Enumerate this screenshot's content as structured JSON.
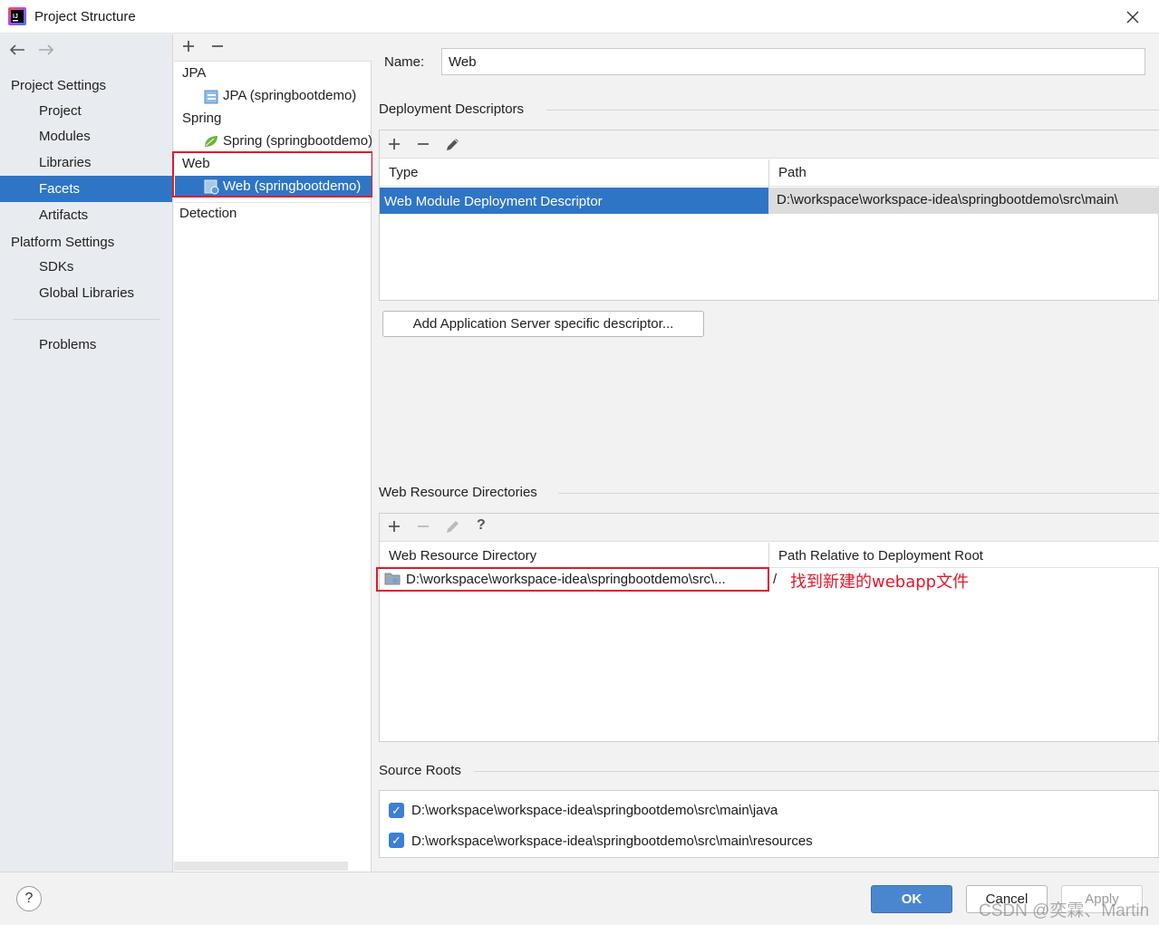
{
  "window": {
    "title": "Project Structure"
  },
  "nav": {
    "project_settings": "Project Settings",
    "items_project": [
      "Project",
      "Modules",
      "Libraries",
      "Facets",
      "Artifacts"
    ],
    "platform_settings": "Platform Settings",
    "items_platform": [
      "SDKs",
      "Global Libraries"
    ],
    "problems": "Problems",
    "selected": "Facets"
  },
  "tree": {
    "groups": [
      {
        "label": "JPA",
        "child": "JPA (springbootdemo)"
      },
      {
        "label": "Spring",
        "child": "Spring (springbootdemo)"
      },
      {
        "label": "Web",
        "child": "Web (springbootdemo)"
      }
    ],
    "detection": "Detection"
  },
  "name_field": {
    "label": "Name:",
    "value": "Web"
  },
  "deployment": {
    "title": "Deployment Descriptors",
    "columns": [
      "Type",
      "Path"
    ],
    "rows": [
      {
        "type": "Web Module Deployment Descriptor",
        "path": "D:\\workspace\\workspace-idea\\springbootdemo\\src\\main\\"
      }
    ],
    "add_button": "Add Application Server specific descriptor..."
  },
  "web_resources": {
    "title": "Web Resource Directories",
    "columns": [
      "Web Resource Directory",
      "Path Relative to Deployment Root"
    ],
    "rows": [
      {
        "directory": "D:\\workspace\\workspace-idea\\springbootdemo\\src\\...",
        "relative": "/"
      }
    ],
    "annotation": "找到新建的webapp文件"
  },
  "source_roots": {
    "title": "Source Roots",
    "items": [
      {
        "path": "D:\\workspace\\workspace-idea\\springbootdemo\\src\\main\\java",
        "checked": true
      },
      {
        "path": "D:\\workspace\\workspace-idea\\springbootdemo\\src\\main\\resources",
        "checked": true
      }
    ]
  },
  "footer": {
    "help": "?",
    "ok": "OK",
    "cancel": "Cancel",
    "apply": "Apply"
  },
  "watermark": "CSDN @奕霖、Martin",
  "colors": {
    "selection": "#2f75c6",
    "annotation_red": "#e0192b",
    "ok_button": "#4a86d0"
  }
}
